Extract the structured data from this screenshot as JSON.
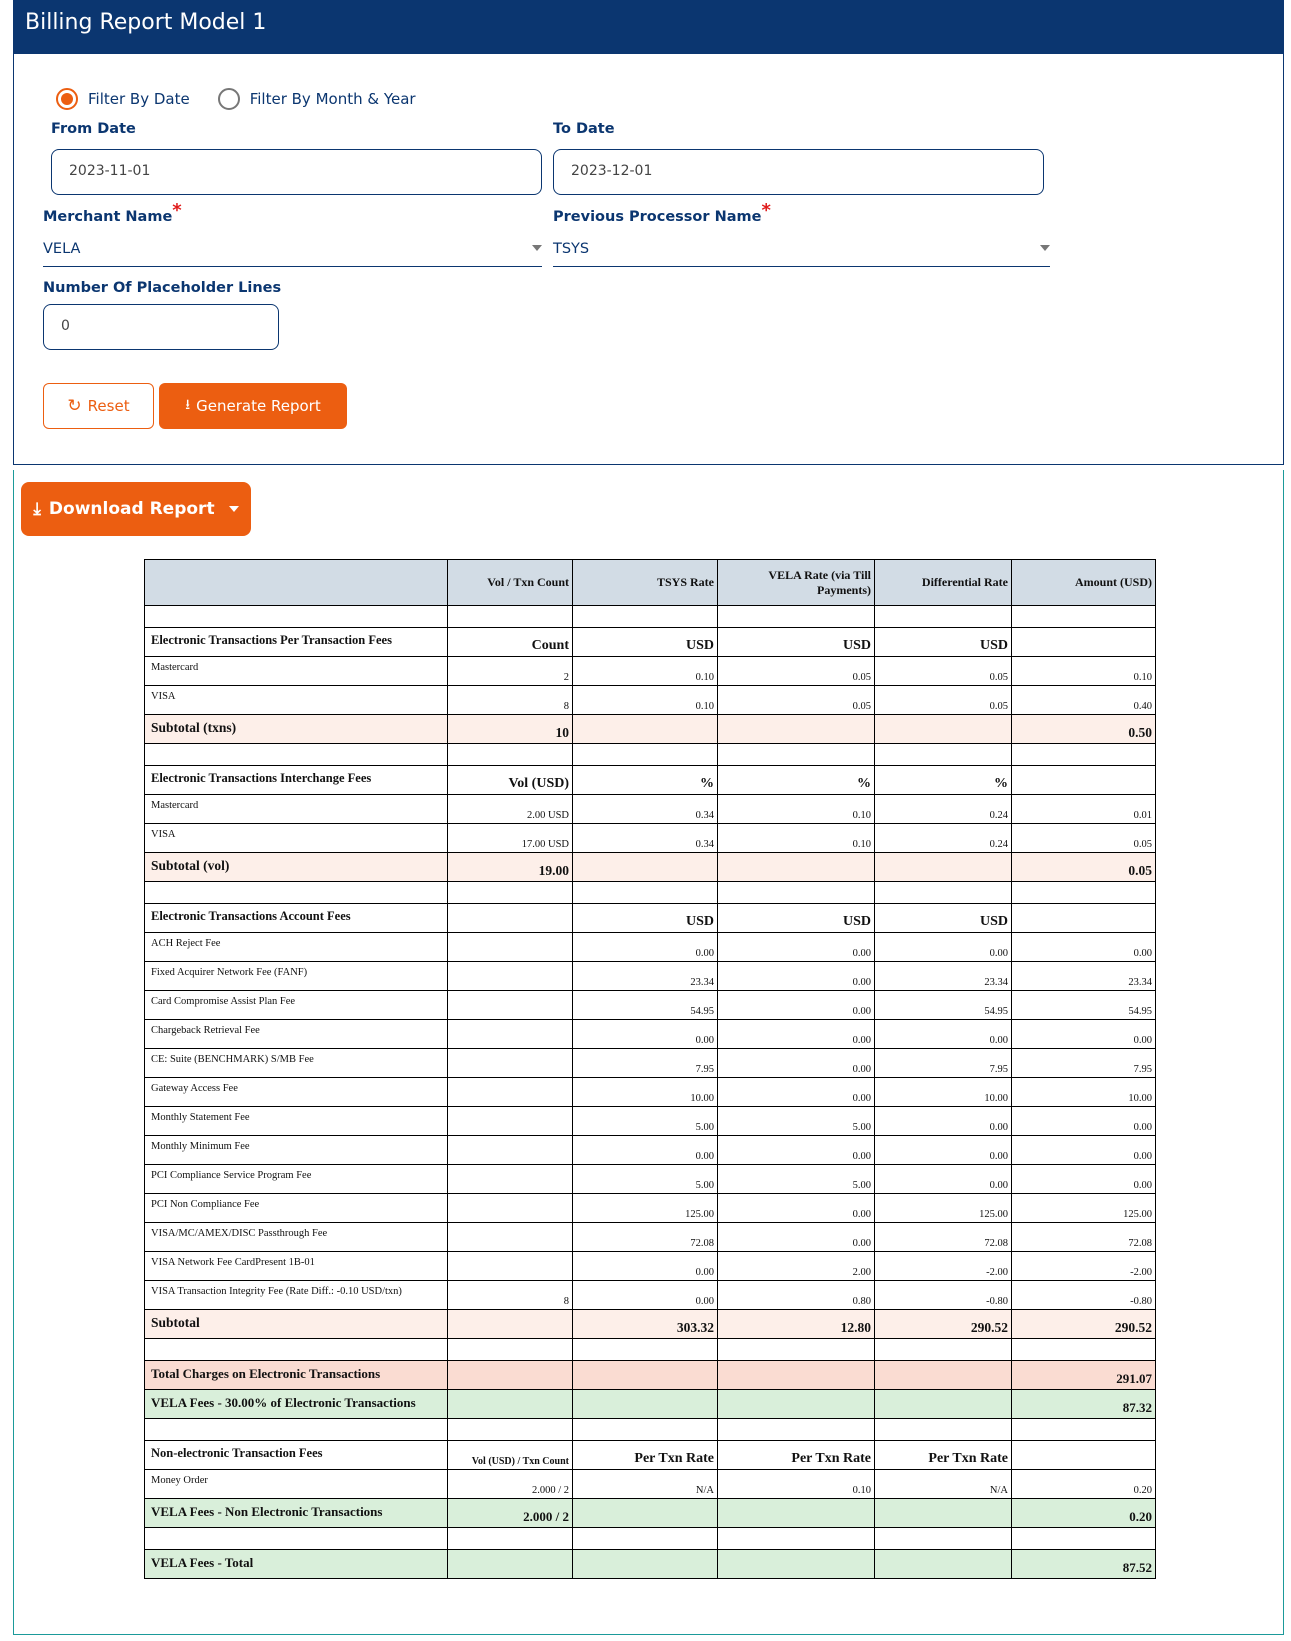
{
  "header": {
    "title": "Billing Report Model 1"
  },
  "filters": {
    "radio_options": [
      {
        "label": "Filter By Date",
        "selected": true
      },
      {
        "label": "Filter By Month & Year",
        "selected": false
      }
    ],
    "from_date": {
      "label": "From Date",
      "value": "2023-11-01"
    },
    "to_date": {
      "label": "To Date",
      "value": "2023-12-01"
    },
    "merchant": {
      "label": "Merchant Name",
      "required": "*",
      "value": "VELA"
    },
    "processor": {
      "label": "Previous Processor Name",
      "required": "*",
      "value": "TSYS"
    },
    "placeholder_lines": {
      "label": "Number Of Placeholder Lines",
      "value": "0"
    },
    "reset_label": "Reset",
    "generate_label": "Generate Report"
  },
  "download": {
    "label": "Download Report"
  },
  "accent_color": "#ec5e11",
  "brand_color": "#0b3670",
  "report": {
    "columns": [
      "",
      "Vol / Txn Count",
      "TSYS Rate",
      "VELA Rate (via Till Payments)",
      "Differential Rate",
      "Amount (USD)"
    ],
    "per_txn": {
      "title": "Electronic Transactions Per Transaction Fees",
      "units": [
        "Count",
        "USD",
        "USD",
        "USD",
        ""
      ],
      "rows": [
        [
          "Mastercard",
          "2",
          "0.10",
          "0.05",
          "0.05",
          "0.10"
        ],
        [
          "VISA",
          "8",
          "0.10",
          "0.05",
          "0.05",
          "0.40"
        ]
      ],
      "subtotal": [
        "Subtotal (txns)",
        "10",
        "",
        "",
        "",
        "0.50"
      ]
    },
    "interchange": {
      "title": "Electronic Transactions Interchange Fees",
      "units": [
        "Vol (USD)",
        "%",
        "%",
        "%",
        ""
      ],
      "rows": [
        [
          "Mastercard",
          "2.00 USD",
          "0.34",
          "0.10",
          "0.24",
          "0.01"
        ],
        [
          "VISA",
          "17.00 USD",
          "0.34",
          "0.10",
          "0.24",
          "0.05"
        ]
      ],
      "subtotal": [
        "Subtotal (vol)",
        "19.00",
        "",
        "",
        "",
        "0.05"
      ]
    },
    "account": {
      "title": "Electronic Transactions Account Fees",
      "units": [
        "",
        "USD",
        "USD",
        "USD",
        ""
      ],
      "rows": [
        [
          "ACH Reject Fee",
          "",
          "0.00",
          "0.00",
          "0.00",
          "0.00"
        ],
        [
          "Fixed Acquirer Network Fee (FANF)",
          "",
          "23.34",
          "0.00",
          "23.34",
          "23.34"
        ],
        [
          "Card Compromise Assist Plan Fee",
          "",
          "54.95",
          "0.00",
          "54.95",
          "54.95"
        ],
        [
          "Chargeback Retrieval Fee",
          "",
          "0.00",
          "0.00",
          "0.00",
          "0.00"
        ],
        [
          "CE: Suite (BENCHMARK) S/MB Fee",
          "",
          "7.95",
          "0.00",
          "7.95",
          "7.95"
        ],
        [
          "Gateway Access Fee",
          "",
          "10.00",
          "0.00",
          "10.00",
          "10.00"
        ],
        [
          "Monthly Statement Fee",
          "",
          "5.00",
          "5.00",
          "0.00",
          "0.00"
        ],
        [
          "Monthly Minimum Fee",
          "",
          "0.00",
          "0.00",
          "0.00",
          "0.00"
        ],
        [
          "PCI Compliance Service Program Fee",
          "",
          "5.00",
          "5.00",
          "0.00",
          "0.00"
        ],
        [
          "PCI Non Compliance Fee",
          "",
          "125.00",
          "0.00",
          "125.00",
          "125.00"
        ],
        [
          "VISA/MC/AMEX/DISC Passthrough Fee",
          "",
          "72.08",
          "0.00",
          "72.08",
          "72.08"
        ],
        [
          "VISA Network Fee CardPresent 1B-01",
          "",
          "0.00",
          "2.00",
          "-2.00",
          "-2.00"
        ],
        [
          "VISA Transaction Integrity Fee (Rate Diff.: -0.10 USD/txn)",
          "8",
          "0.00",
          "0.80",
          "-0.80",
          "-0.80"
        ]
      ],
      "subtotal": [
        "Subtotal",
        "",
        "303.32",
        "12.80",
        "290.52",
        "290.52"
      ]
    },
    "total_electronic": [
      "Total Charges on Electronic Transactions",
      "",
      "",
      "",
      "",
      "291.07"
    ],
    "vela_electronic": [
      "VELA Fees - 30.00% of Electronic Transactions",
      "",
      "",
      "",
      "",
      "87.32"
    ],
    "non_electronic": {
      "title": "Non-electronic Transaction Fees",
      "units": [
        "Vol (USD) / Txn Count",
        "Per Txn Rate",
        "Per Txn Rate",
        "Per Txn Rate",
        ""
      ],
      "rows": [
        [
          "Money Order",
          "2.000 / 2",
          "N/A",
          "0.10",
          "N/A",
          "0.20"
        ]
      ],
      "subtotal": [
        "VELA Fees - Non Electronic Transactions",
        "2.000 / 2",
        "",
        "",
        "",
        "0.20"
      ]
    },
    "vela_total": [
      "VELA Fees - Total",
      "",
      "",
      "",
      "",
      "87.52"
    ]
  }
}
